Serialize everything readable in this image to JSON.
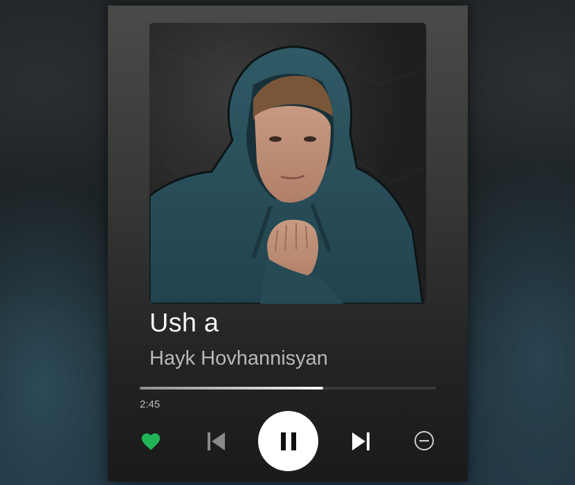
{
  "song": {
    "title": "Ush a",
    "artist": "Hayk Hovhannisyan"
  },
  "playback": {
    "elapsed": "2:45",
    "progress": 0.62,
    "state": "playing"
  },
  "icons": {
    "like": "heart-icon",
    "previous": "skip-previous-icon",
    "pause": "pause-icon",
    "next": "skip-next-icon",
    "remove": "minus-circle-icon"
  },
  "colors": {
    "accent": "#1db954",
    "like_color": "#21b358",
    "prev_disabled": "#8a8a8a",
    "control": "#ffffff"
  }
}
